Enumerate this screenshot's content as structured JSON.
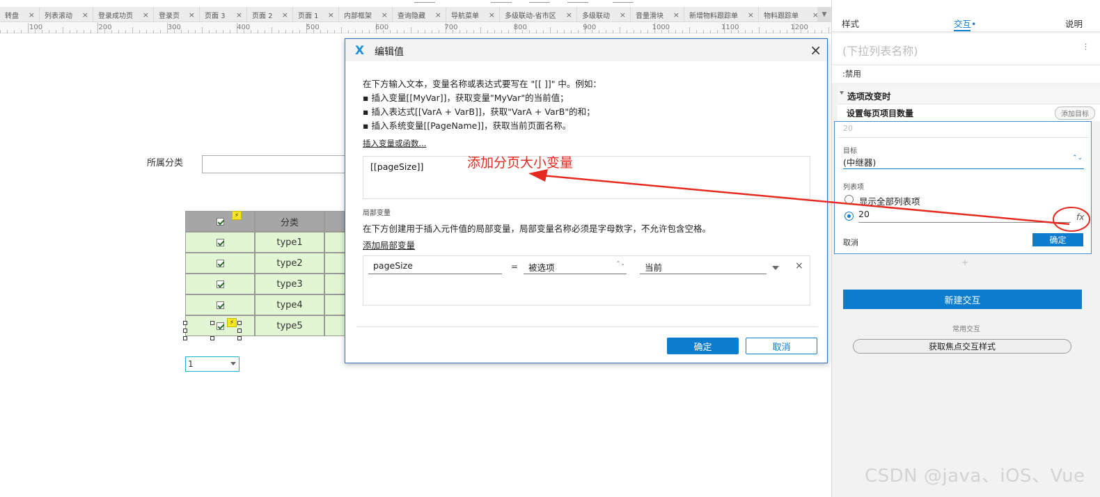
{
  "tabs": [
    {
      "label": "转盘",
      "width": 57
    },
    {
      "label": "列表滚动",
      "width": 77
    },
    {
      "label": "登录成功页",
      "width": 87
    },
    {
      "label": "登录页",
      "width": 66
    },
    {
      "label": "页面 3",
      "width": 68
    },
    {
      "label": "页面 2",
      "width": 66
    },
    {
      "label": "页面 1",
      "width": 66
    },
    {
      "label": "内部框架",
      "width": 77
    },
    {
      "label": "查询隐藏",
      "width": 77
    },
    {
      "label": "导航菜单",
      "width": 77
    },
    {
      "label": "多级联动-省市区",
      "width": 111
    },
    {
      "label": "多级联动",
      "width": 77
    },
    {
      "label": "音量滑块",
      "width": 77
    },
    {
      "label": "新增物料跟踪单",
      "width": 107
    },
    {
      "label": "物料跟踪单",
      "width": 93
    }
  ],
  "tab_close_glyph": "×",
  "ruler": [
    "100",
    "200",
    "300",
    "400",
    "500",
    "600",
    "700",
    "800",
    "900",
    "1000",
    "1100",
    "1200"
  ],
  "canvas": {
    "category_label": "所属分类",
    "table": {
      "header": [
        "分类"
      ],
      "rows": [
        "type1",
        "type2",
        "type3",
        "type4",
        "type5"
      ]
    },
    "bolt_glyph": "⚡",
    "pager_value": "1"
  },
  "dialog": {
    "logo": "X",
    "title": "编辑值",
    "close_glyph": "×",
    "intro": [
      "在下方输入文本，变量名称或表达式要写在 \"[[ ]]\" 中。例如：",
      "▪ 插入变量[[MyVar]]，获取变量\"MyVar\"的当前值；",
      "▪ 插入表达式[[VarA + VarB]]，获取\"VarA + VarB\"的和；",
      "▪ 插入系统变量[[PageName]]，获取当前页面名称。"
    ],
    "insert_link": "插入变量或函数...",
    "editor_text": "[[pageSize]]",
    "local_vars_title": "局部变量",
    "local_vars_desc": "在下方创建用于插入元件值的局部变量，局部变量名称必须是字母数字，不允许包含空格。",
    "add_local_link": "添加局部变量",
    "local_var": {
      "name": "pageSize",
      "equals": "=",
      "type": "被选项",
      "source": "当前",
      "delete_glyph": "×",
      "spinner": "⌃⌄"
    },
    "ok_label": "确定",
    "cancel_label": "取消"
  },
  "annotation": {
    "text": "添加分页大小变量",
    "color": "#e52b20"
  },
  "right_panel": {
    "tabs": [
      {
        "label": "样式",
        "active": false
      },
      {
        "label": "交互",
        "active": true
      },
      {
        "label": "说明",
        "active": false
      }
    ],
    "active_dot": "•",
    "widget_name_placeholder": "(下拉列表名称)",
    "settings_icon": "⫶",
    "disabled_label": ":禁用",
    "event_label": "选项改变时",
    "action_label": "设置每页项目数量",
    "add_target_label": "添加目标",
    "summary_value": "20",
    "target_label": "目标",
    "target_value": "(中继器)",
    "target_chevron": "⌃⌄",
    "list_items_label": "列表项",
    "show_all_label": "显示全部列表项",
    "count_value": "20",
    "fx_label": "fx",
    "cancel_label": "取消",
    "ok_label": "确定",
    "plus": "+",
    "new_interaction_label": "新建交互",
    "common_label": "常用交互",
    "focus_style_label": "获取焦点交互样式"
  },
  "watermark": "CSDN @java、iOS、Vue",
  "colors": {
    "primary": "#0c7ccf",
    "table_header": "#a6a6a6",
    "table_row": "#e3f6d3",
    "annotation": "#e52b20"
  }
}
